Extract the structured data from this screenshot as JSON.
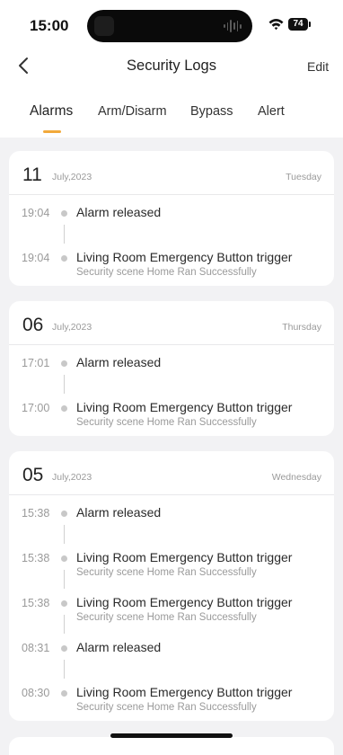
{
  "status_bar": {
    "time": "15:00",
    "battery": "74"
  },
  "header": {
    "title": "Security Logs",
    "edit_label": "Edit"
  },
  "tabs": [
    {
      "label": "Alarms",
      "active": true
    },
    {
      "label": "Arm/Disarm",
      "active": false
    },
    {
      "label": "Bypass",
      "active": false
    },
    {
      "label": "Alert",
      "active": false
    }
  ],
  "colors": {
    "accent": "#f2a93b",
    "background": "#f2f2f4",
    "card": "#ffffff"
  },
  "days": [
    {
      "day": "11",
      "month_year": "July,2023",
      "weekday": "Tuesday",
      "entries": [
        {
          "time": "19:04",
          "title": "Alarm released",
          "subtitle": ""
        },
        {
          "time": "19:04",
          "title": "Living Room Emergency Button trigger",
          "subtitle": "Security scene Home Ran Successfully"
        }
      ]
    },
    {
      "day": "06",
      "month_year": "July,2023",
      "weekday": "Thursday",
      "entries": [
        {
          "time": "17:01",
          "title": "Alarm released",
          "subtitle": ""
        },
        {
          "time": "17:00",
          "title": "Living Room Emergency Button trigger",
          "subtitle": "Security scene Home Ran Successfully"
        }
      ]
    },
    {
      "day": "05",
      "month_year": "July,2023",
      "weekday": "Wednesday",
      "entries": [
        {
          "time": "15:38",
          "title": "Alarm released",
          "subtitle": ""
        },
        {
          "time": "15:38",
          "title": "Living Room Emergency Button trigger",
          "subtitle": "Security scene Home Ran Successfully"
        },
        {
          "time": "15:38",
          "title": "Living Room Emergency Button trigger",
          "subtitle": "Security scene Home Ran Successfully"
        },
        {
          "time": "08:31",
          "title": "Alarm released",
          "subtitle": ""
        },
        {
          "time": "08:30",
          "title": "Living Room Emergency Button trigger",
          "subtitle": "Security scene Home Ran Successfully"
        }
      ]
    }
  ]
}
